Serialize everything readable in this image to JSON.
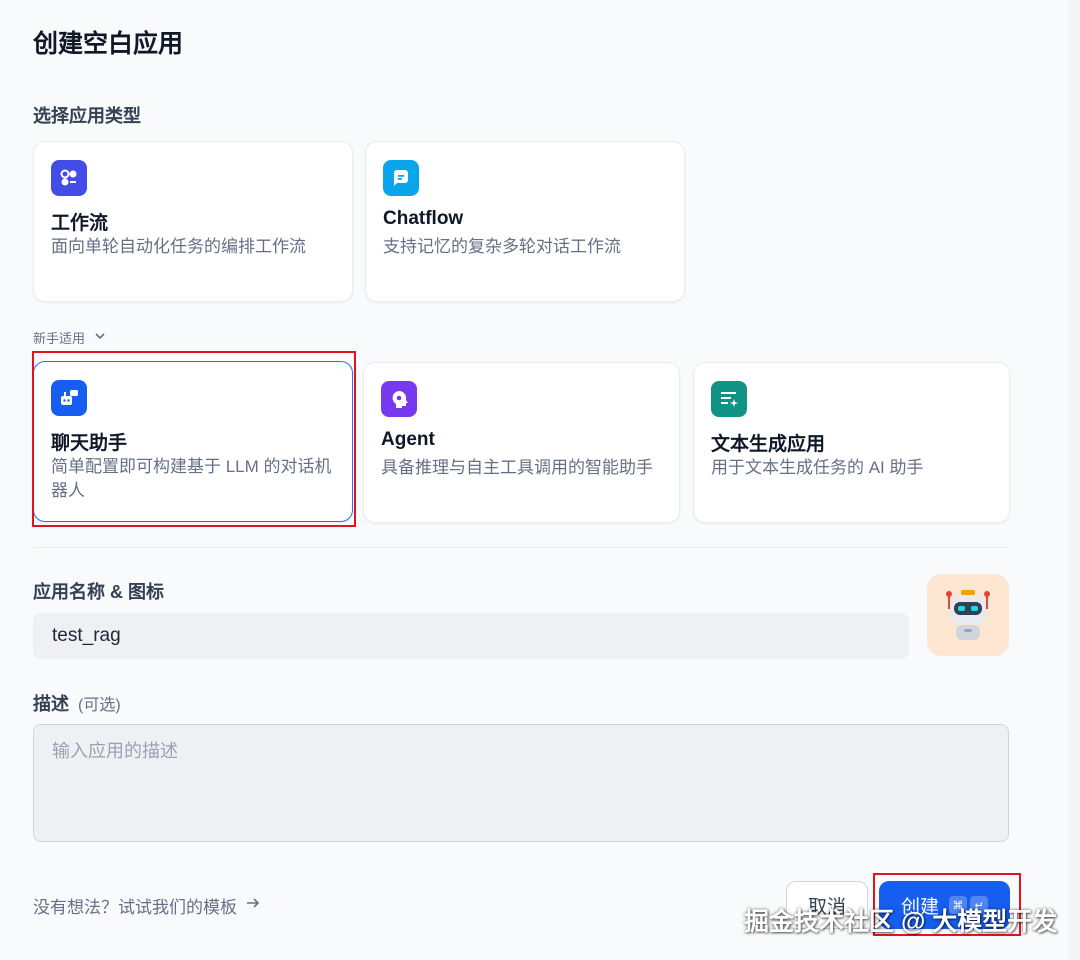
{
  "dialog": {
    "title": "创建空白应用"
  },
  "type_section": {
    "label": "选择应用类型"
  },
  "primary_types": [
    {
      "title": "工作流",
      "desc": "面向单轮自动化任务的编排工作流",
      "icon": "workflow-icon",
      "color": "#444ce7"
    },
    {
      "title": "Chatflow",
      "desc": "支持记忆的复杂多轮对话工作流",
      "icon": "chatflow-icon",
      "color": "#0ba5ec"
    }
  ],
  "beginner": {
    "label": "新手适用",
    "expanded": true
  },
  "beginner_types": [
    {
      "title": "聊天助手",
      "desc": "简单配置即可构建基于 LLM 的对话机器人",
      "icon": "chatbot-icon",
      "color": "#155eef",
      "selected": true
    },
    {
      "title": "Agent",
      "desc": "具备推理与自主工具调用的智能助手",
      "icon": "agent-icon",
      "color": "#7839ee"
    },
    {
      "title": "文本生成应用",
      "desc": "用于文本生成任务的 AI 助手",
      "icon": "text-generation-icon",
      "color": "#0e9384"
    }
  ],
  "name_section": {
    "label": "应用名称 & 图标",
    "value": "test_rag",
    "avatar": "robot-avatar-icon"
  },
  "desc_section": {
    "label": "描述",
    "optional": "(可选)",
    "placeholder": "输入应用的描述"
  },
  "footer": {
    "template_link": "没有想法？试试我们的模板",
    "cancel": "取消",
    "create": "创建",
    "shortcut_keys": [
      "⌘",
      "↵"
    ]
  },
  "watermark": "掘金技术社区 @ 大模型开发",
  "colors": {
    "primary": "#155eef",
    "highlight": "#e3131b",
    "avatar_bg": "#fde7d3"
  }
}
